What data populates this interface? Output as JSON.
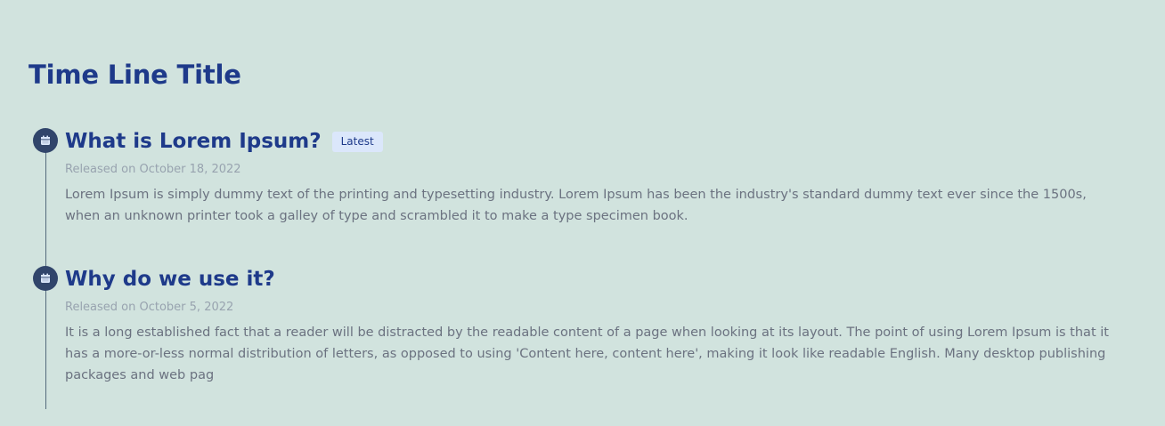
{
  "timeline": {
    "title": "Time Line Title",
    "items": [
      {
        "title": "What is Lorem Ipsum?",
        "badge": "Latest",
        "date": "Released on October 18, 2022",
        "body": "Lorem Ipsum is simply dummy text of the printing and typesetting industry. Lorem Ipsum has been the industry's standard dummy text ever since the 1500s, when an unknown printer took a galley of type and scrambled it to make a type specimen book.",
        "icon": "calendar-icon"
      },
      {
        "title": "Why do we use it?",
        "date": "Released on October 5, 2022",
        "body": "It is a long established fact that a reader will be distracted by the readable content of a page when looking at its layout. The point of using Lorem Ipsum is that it has a more-or-less normal distribution of letters, as opposed to using 'Content here, content here', making it look like readable English. Many desktop publishing packages and web pag",
        "icon": "calendar-icon"
      }
    ]
  },
  "colors": {
    "background": "#d1e3de",
    "title": "#1e3a8a",
    "dot": "#31456b",
    "badge_bg": "#dbe7fb",
    "date": "#98a3af",
    "body": "#6b7280"
  }
}
